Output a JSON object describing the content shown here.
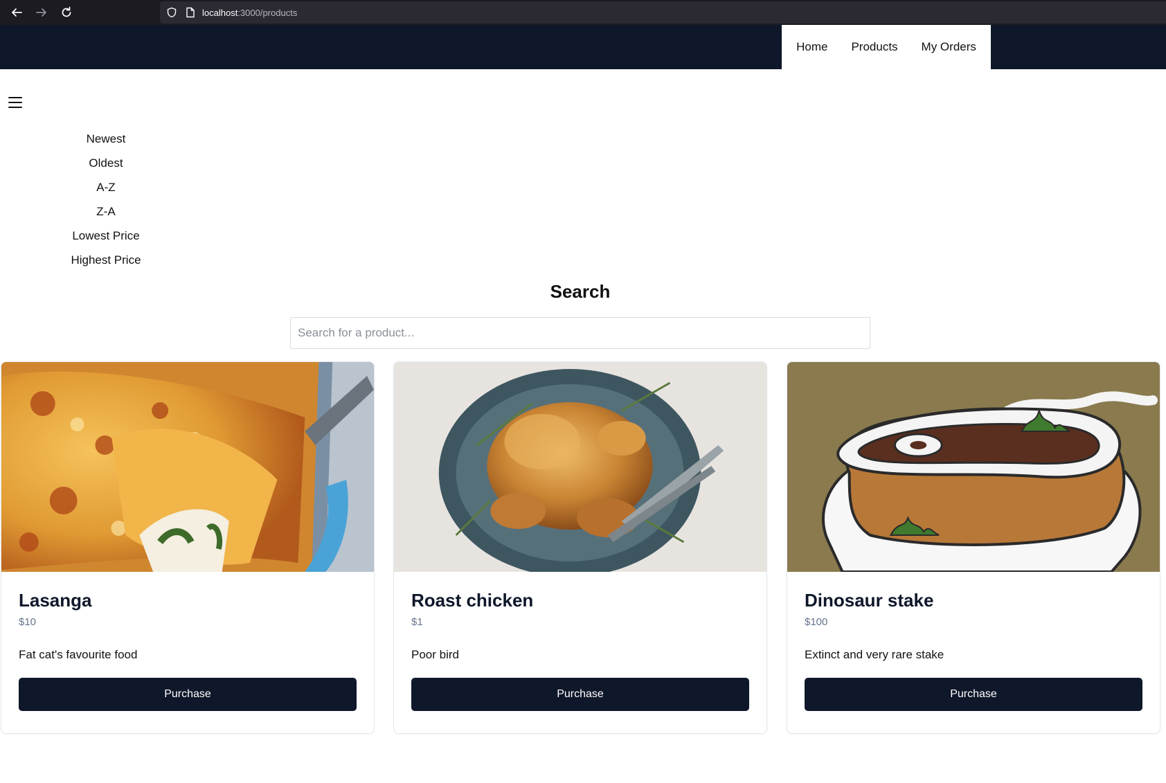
{
  "browser": {
    "url_host": "localhost",
    "url_path": ":3000/products"
  },
  "nav": {
    "items": [
      "Home",
      "Products",
      "My Orders"
    ]
  },
  "sort": {
    "options": [
      "Newest",
      "Oldest",
      "A-Z",
      "Z-A",
      "Lowest Price",
      "Highest Price"
    ]
  },
  "search": {
    "title": "Search",
    "placeholder": "Search for a product..."
  },
  "products": [
    {
      "name": "Lasanga",
      "price": "$10",
      "description": "Fat cat's favourite food",
      "button": "Purchase",
      "image": "lasagna-photo"
    },
    {
      "name": "Roast chicken",
      "price": "$1",
      "description": "Poor bird",
      "button": "Purchase",
      "image": "roast-chicken-photo"
    },
    {
      "name": "Dinosaur stake",
      "price": "$100",
      "description": "Extinct and very rare stake",
      "button": "Purchase",
      "image": "dinosaur-steak-cartoon"
    }
  ],
  "colors": {
    "header_bg": "#0f172a",
    "button_bg": "#0f172a",
    "browser_bg": "#1c1b22",
    "price_text": "#64748b"
  }
}
